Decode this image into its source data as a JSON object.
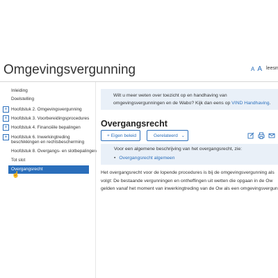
{
  "header": {
    "title": "Omgevingsvergunning",
    "font_small": "A",
    "font_large": "A",
    "read_label": "leesmo"
  },
  "sidebar": {
    "items": [
      {
        "label": "Inleiding",
        "expandable": false
      },
      {
        "label": "Doelstelling",
        "expandable": false
      },
      {
        "label": "Hoofdstuk 2. Omgevingsvergunning",
        "expandable": true
      },
      {
        "label": "Hoofdstuk 3. Voorbereidingsprocedures",
        "expandable": true
      },
      {
        "label": "Hoofdstuk 4. Financiële bepalingen",
        "expandable": true
      },
      {
        "label": "Hoofdstuk 6. Inwerkingtreding",
        "label2": "beschikkingen en rechtsbescherming",
        "expandable": true
      },
      {
        "label": "Hoofdstuk 8. Overgangs- en slotbepalingen",
        "expandable": false
      },
      {
        "label": "Tot slot",
        "expandable": false
      },
      {
        "label": "Overgangsrecht",
        "expandable": false,
        "active": true
      }
    ]
  },
  "info": {
    "line1": "Wilt u meer weten over toezicht op en handhaving van",
    "line2_prefix": "omgevingsvergunningen en de Wabo? Kijk dan eens op ",
    "link": "VIND Handhaving",
    "line2_suffix": "."
  },
  "main": {
    "section_title": "Overgangsrecht",
    "own_button": "Eigen beleid",
    "related_button": "Gerelateerd",
    "description": "Voor een algemene beschrijving van het overgangsrecht, zie:",
    "bullet_link": "Overgangsrecht algemeen",
    "body_line1": "Het overgangsrecht voor de lopende procedures is bij de omgevingsvergunning als",
    "body_line2": "volgt: De bestaande vergunningen en ontheffingen uit wetten die opgaan in de Ow",
    "body_line3": "gelden vanaf het moment van inwerkingtreding van de Ow als een omgevingsvergunning"
  },
  "colors": {
    "accent": "#2a6ebb",
    "info_bg": "#e9f0f8"
  },
  "icons": [
    "plus-icon",
    "chevron-down-icon",
    "edit-icon",
    "print-icon",
    "mail-icon",
    "pointer-cursor-icon"
  ]
}
